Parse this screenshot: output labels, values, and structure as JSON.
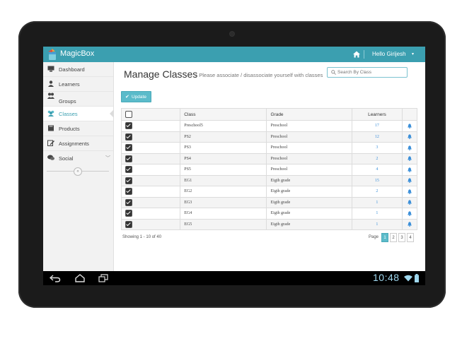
{
  "app": {
    "brand": "MagicBox",
    "greeting": "Hello Girijesh"
  },
  "sidebar": {
    "items": [
      {
        "label": "Dashboard",
        "icon": "monitor-icon"
      },
      {
        "label": "Learners",
        "icon": "user-icon"
      },
      {
        "label": "Groups",
        "icon": "users-icon"
      },
      {
        "label": "Classes",
        "icon": "class-icon",
        "active": true
      },
      {
        "label": "Products",
        "icon": "book-icon"
      },
      {
        "label": "Assignments",
        "icon": "edit-icon"
      },
      {
        "label": "Social",
        "icon": "chat-icon"
      }
    ]
  },
  "main": {
    "title": "Manage Classes",
    "subtitle": "» Please associate / disassociate yourself with classes",
    "search_placeholder": "Search By Class",
    "update_label": "Update"
  },
  "table": {
    "headers": {
      "class": "Class",
      "grade": "Grade",
      "learners": "Learners"
    },
    "rows": [
      {
        "class": "Preschool5",
        "grade": "Preschool",
        "learners": "17",
        "checked": true
      },
      {
        "class": "PS2",
        "grade": "Preschool",
        "learners": "12",
        "checked": true
      },
      {
        "class": "PS3",
        "grade": "Preschool",
        "learners": "3",
        "checked": true
      },
      {
        "class": "PS4",
        "grade": "Preschool",
        "learners": "2",
        "checked": true
      },
      {
        "class": "PS5",
        "grade": "Preschool",
        "learners": "4",
        "checked": true
      },
      {
        "class": "EG1",
        "grade": "Eigth grade",
        "learners": "15",
        "checked": true
      },
      {
        "class": "EG2",
        "grade": "Eigth grade",
        "learners": "2",
        "checked": true
      },
      {
        "class": "EG3",
        "grade": "Eigth grade",
        "learners": "1",
        "checked": true
      },
      {
        "class": "EG4",
        "grade": "Eigth grade",
        "learners": "1",
        "checked": true
      },
      {
        "class": "EG5",
        "grade": "Eigth grade",
        "learners": "1",
        "checked": true
      }
    ]
  },
  "footer": {
    "info": "Showing 1 - 10 of 40",
    "page_label": "Page",
    "pages": [
      "1",
      "2",
      "3",
      "4"
    ],
    "current_page": "1"
  },
  "status_bar": {
    "time": "10:48"
  },
  "colors": {
    "accent": "#3b9fb0",
    "button": "#5bbbca",
    "link": "#3b8fd9"
  }
}
